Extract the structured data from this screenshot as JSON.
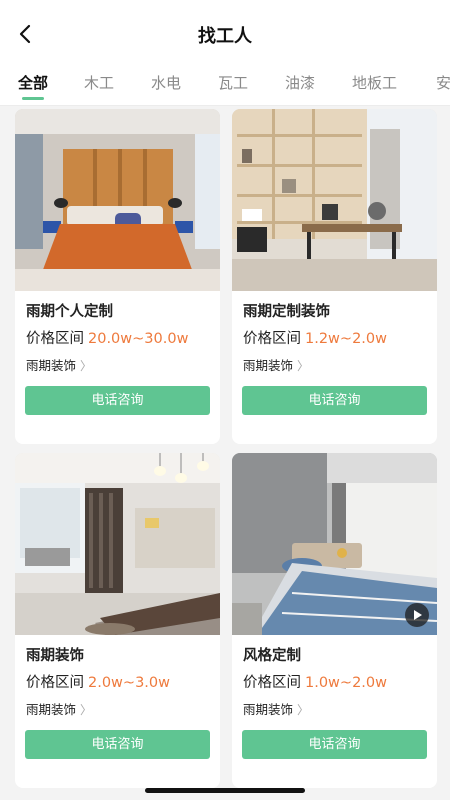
{
  "header": {
    "title": "找工人",
    "back_icon": "chevron-left-icon"
  },
  "tabs": [
    {
      "label": "全部",
      "active": true
    },
    {
      "label": "木工",
      "active": false
    },
    {
      "label": "水电",
      "active": false
    },
    {
      "label": "瓦工",
      "active": false
    },
    {
      "label": "油漆",
      "active": false
    },
    {
      "label": "地板工",
      "active": false
    },
    {
      "label": "安",
      "active": false
    }
  ],
  "price_label": "价格区间",
  "call_label": "电话咨询",
  "cards": [
    {
      "name": "雨期个人定制",
      "price": "20.0w~30.0w",
      "shop": "雨期装饰",
      "has_video": false
    },
    {
      "name": "雨期定制装饰",
      "price": "1.2w~2.0w",
      "shop": "雨期装饰",
      "has_video": false
    },
    {
      "name": "雨期装饰",
      "price": "2.0w~3.0w",
      "shop": "雨期装饰",
      "has_video": false
    },
    {
      "name": "风格定制",
      "price": "1.0w~2.0w",
      "shop": "雨期装饰",
      "has_video": true
    }
  ],
  "colors": {
    "accent": "#5fc592",
    "price": "#ee7a3d",
    "background": "#f3f3f3"
  }
}
